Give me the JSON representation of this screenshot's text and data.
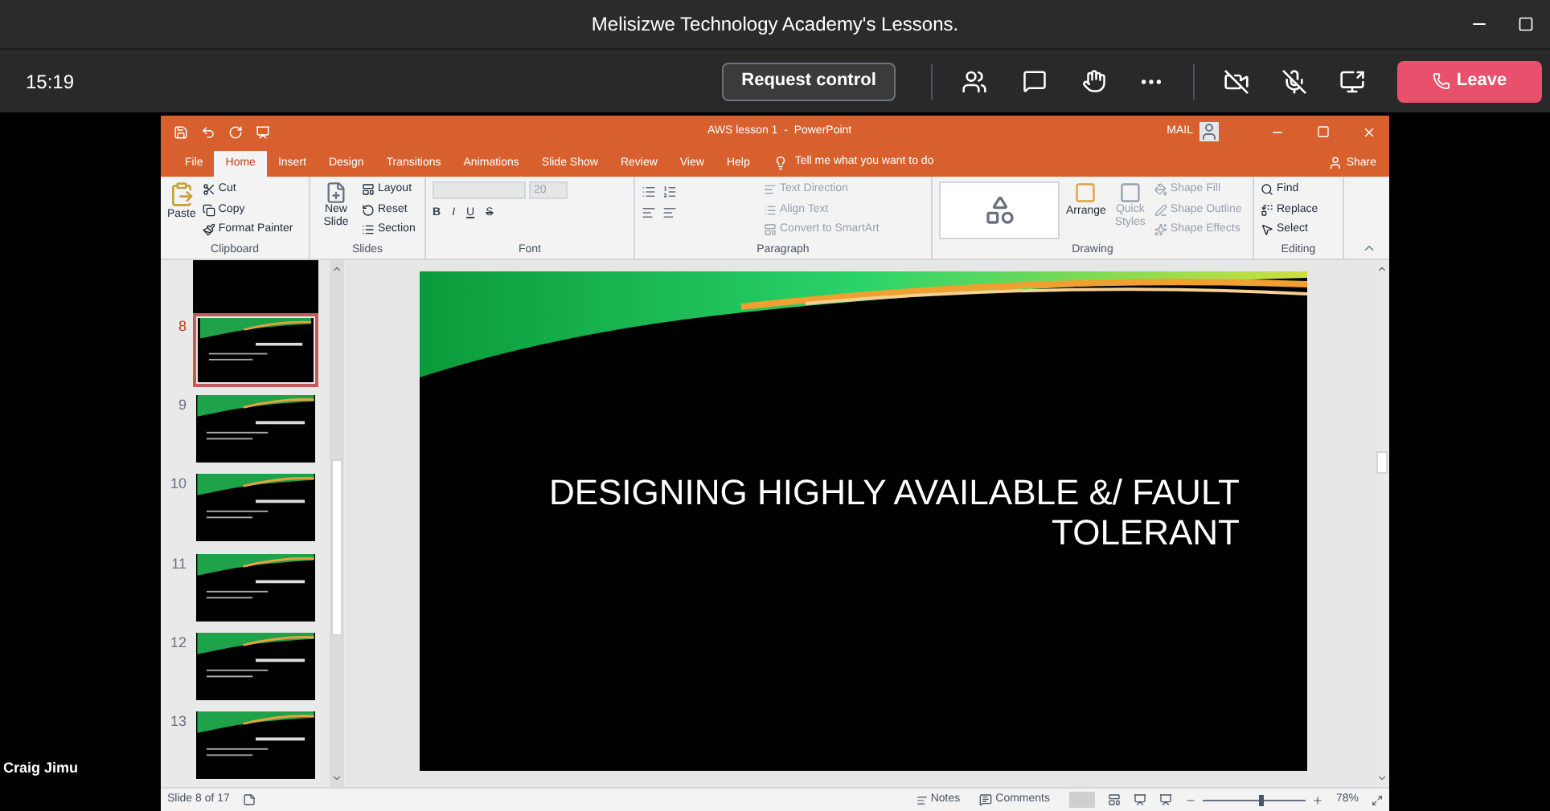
{
  "meeting": {
    "title": "Melisizwe Technology Academy's Lessons.",
    "time": "15:19",
    "request_control": "Request control",
    "leave": "Leave",
    "participant": "Craig Jimu"
  },
  "ppt": {
    "title": "AWS lesson 1  -  PowerPoint",
    "account": "MAIL",
    "tabs": [
      {
        "label": "File",
        "selected": false
      },
      {
        "label": "Home",
        "selected": true
      },
      {
        "label": "Insert",
        "selected": false
      },
      {
        "label": "Design",
        "selected": false
      },
      {
        "label": "Transitions",
        "selected": false
      },
      {
        "label": "Animations",
        "selected": false
      },
      {
        "label": "Slide Show",
        "selected": false
      },
      {
        "label": "Review",
        "selected": false
      },
      {
        "label": "View",
        "selected": false
      },
      {
        "label": "Help",
        "selected": false
      }
    ],
    "tell_me": "Tell me what you want to do",
    "share": "Share",
    "clipboard": {
      "label": "Clipboard",
      "paste": "Paste",
      "cut": "Cut",
      "copy": "Copy",
      "format_painter": "Format Painter"
    },
    "slides": {
      "label": "Slides",
      "new_slide": "New Slide",
      "layout": "Layout",
      "reset": "Reset",
      "section": "Section"
    },
    "font": {
      "label": "Font",
      "size": "20",
      "styles": [
        "B",
        "I",
        "U",
        "S"
      ]
    },
    "paragraph": {
      "label": "Paragraph",
      "items": [
        {
          "label": "Text Direction",
          "disabled": true
        },
        {
          "label": "Align Text",
          "disabled": true
        },
        {
          "label": "Convert to SmartArt",
          "disabled": true
        }
      ]
    },
    "drawing": {
      "label": "Drawing",
      "arrange": "Arrange",
      "quick_styles": "Quick Styles",
      "items": [
        {
          "label": "Shape Fill",
          "disabled": true
        },
        {
          "label": "Shape Outline",
          "disabled": true
        },
        {
          "label": "Shape Effects",
          "disabled": true
        }
      ]
    },
    "editing": {
      "label": "Editing",
      "find": "Find",
      "replace": "Replace",
      "select": "Select"
    },
    "thumbnails": [
      {
        "number": "8",
        "selected": true
      },
      {
        "number": "9",
        "selected": false
      },
      {
        "number": "10",
        "selected": false
      },
      {
        "number": "11",
        "selected": false
      },
      {
        "number": "12",
        "selected": false
      },
      {
        "number": "13",
        "selected": false
      }
    ],
    "slide_title": "DESIGNING HIGHLY AVAILABLE &/ FAULT TOLERANT",
    "status": {
      "slide_info": "Slide 8 of 17",
      "notes": "Notes",
      "comments": "Comments",
      "zoom": "78%",
      "zoom_slider": {
        "level": 0.55
      }
    }
  }
}
